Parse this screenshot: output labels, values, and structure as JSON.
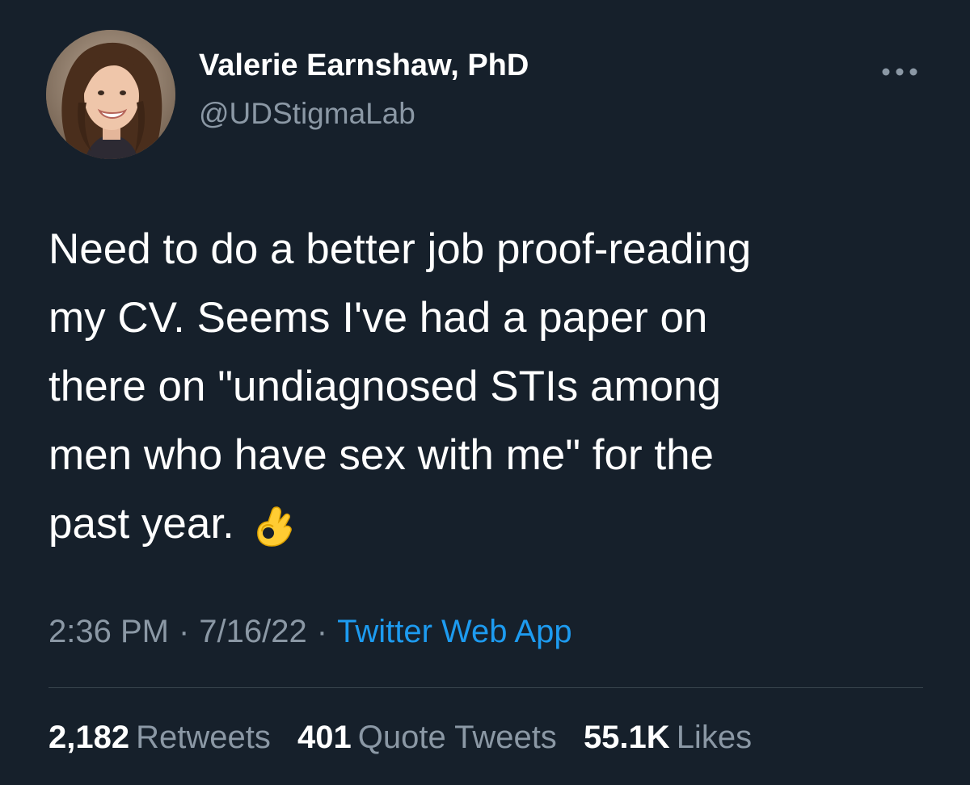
{
  "tweet": {
    "author": {
      "name": "Valerie Earnshaw, PhD",
      "handle": "@UDStigmaLab",
      "avatar_icon": "profile-photo"
    },
    "more_icon": "more-horizontal-icon",
    "text_lines": [
      "Need to do a better job proof-reading",
      "my CV. Seems I've had a paper on",
      "there on \"undiagnosed STIs among",
      "men who have sex with me\" for the",
      "past year."
    ],
    "emoji": "ok-hand-emoji",
    "time": "2:36 PM",
    "separator": "·",
    "date": "7/16/22",
    "source": "Twitter Web App",
    "stats": {
      "retweets_count": "2,182",
      "retweets_label": "Retweets",
      "quotes_count": "401",
      "quotes_label": "Quote Tweets",
      "likes_count": "55.1K",
      "likes_label": "Likes"
    },
    "colors": {
      "background": "#16202b",
      "primary_text": "#ffffff",
      "secondary_text": "#8b98a5",
      "link": "#1d9bf0",
      "divider": "#38444d"
    }
  }
}
